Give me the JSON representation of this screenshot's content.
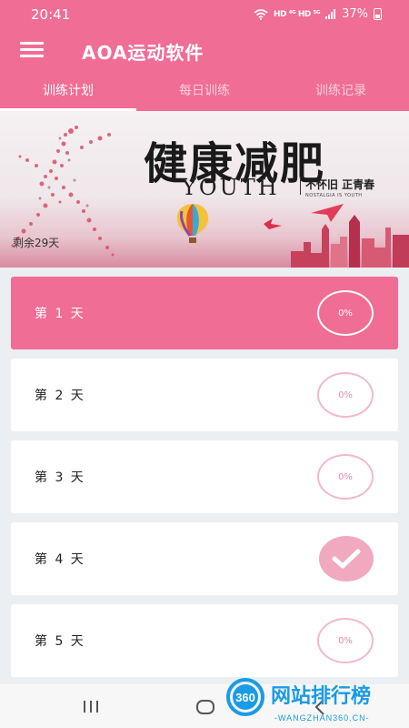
{
  "status_bar": {
    "time": "20:41",
    "network_labels": "HD ⁴ᴳ HD ⁵ᴳ",
    "battery": "37%"
  },
  "app_bar": {
    "title": "AOA运动软件"
  },
  "tabs": [
    {
      "label": "训练计划",
      "active": true
    },
    {
      "label": "每日训练",
      "active": false
    },
    {
      "label": "训练记录",
      "active": false
    }
  ],
  "banner": {
    "title": "健康减肥",
    "subtitle": "YOUTH",
    "slogan": "不怀旧 正青春",
    "small_text": "NOSTALGIA IS YOUTH",
    "remaining": "剩余29天"
  },
  "days": [
    {
      "label": "第 1 天",
      "progress": "0%",
      "completed": false
    },
    {
      "label": "第 2 天",
      "progress": "0%",
      "completed": false
    },
    {
      "label": "第 3 天",
      "progress": "0%",
      "completed": false
    },
    {
      "label": "第 4 天",
      "progress": "",
      "completed": true
    },
    {
      "label": "第 5 天",
      "progress": "0%",
      "completed": false
    }
  ],
  "watermark": {
    "badge": "360",
    "name": "网站排行榜",
    "url": "-WANGZHAN360.CN-"
  },
  "colors": {
    "primary": "#f06d96",
    "ring": "#f3b9cb",
    "done": "#f1a9c0"
  }
}
